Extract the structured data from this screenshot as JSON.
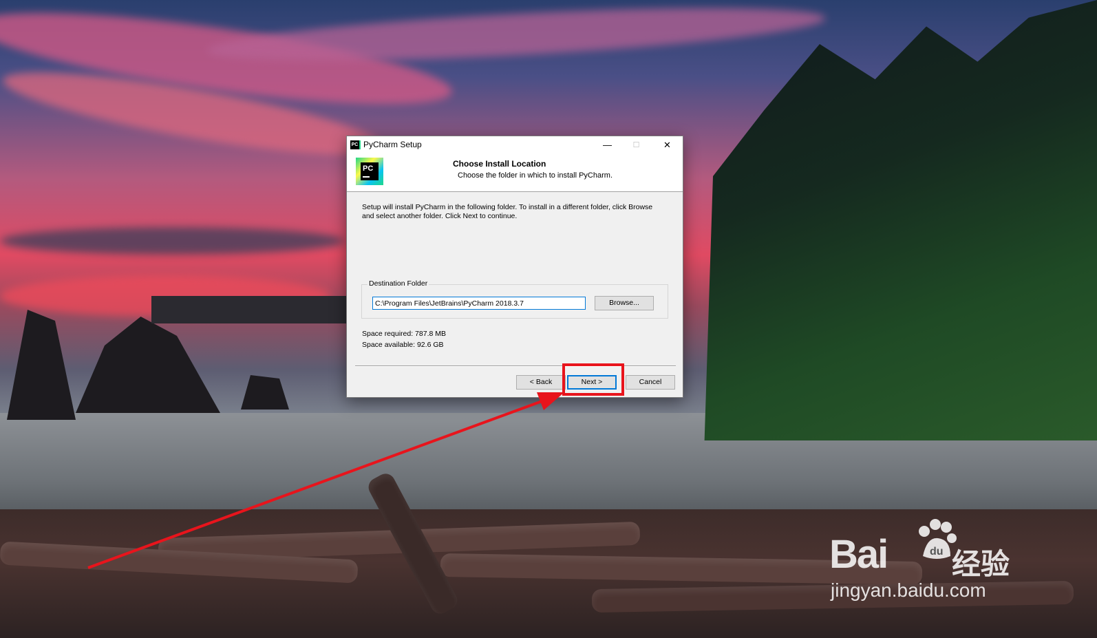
{
  "window": {
    "title": "PyCharm Setup",
    "icon": "pycharm-icon",
    "controls": {
      "minimize": "—",
      "maximize": "☐",
      "close": "✕"
    }
  },
  "header": {
    "title": "Choose Install Location",
    "subtitle": "Choose the folder in which to install PyCharm.",
    "logo": {
      "icon": "pycharm-logo",
      "text": "PC"
    }
  },
  "body": {
    "intro_line1": "Setup will install PyCharm in the following folder. To install in a different folder, click Browse",
    "intro_line2": "and select another folder. Click Next to continue.",
    "destination": {
      "label": "Destination Folder",
      "path": "C:\\Program Files\\JetBrains\\PyCharm 2018.3.7",
      "browse_label": "Browse..."
    },
    "space_required": "Space required: 787.8 MB",
    "space_available": "Space available: 92.6 GB"
  },
  "footer": {
    "back_label": "< Back",
    "next_label": "Next >",
    "cancel_label": "Cancel"
  },
  "annotation": {
    "highlight_color": "#e8141c",
    "target": "next-button"
  },
  "watermark": {
    "brand": "Bai",
    "brand_cn": "经验",
    "url": "jingyan.baidu.com"
  }
}
